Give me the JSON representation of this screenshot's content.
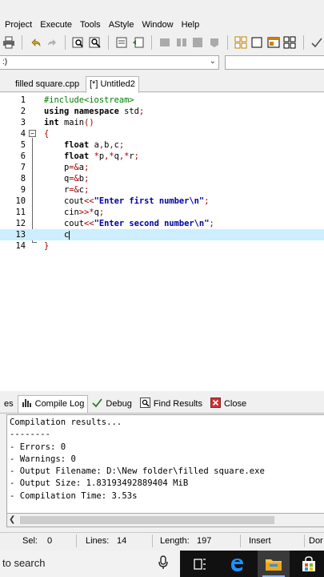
{
  "menu": [
    "Project",
    "Execute",
    "Tools",
    "AStyle",
    "Window",
    "Help"
  ],
  "toolbar": {
    "icons": [
      "print-icon",
      "undo-icon",
      "redo-icon",
      "find-icon",
      "replace-icon",
      "goto-icon",
      "bookmark-icon",
      "compile-icon",
      "run-icon",
      "rebuild-icon",
      "debug-icon",
      "grid-icon",
      "window-icon",
      "layout-icon",
      "tiles-icon",
      "check-icon"
    ]
  },
  "combo": {
    "value": ":)"
  },
  "editor_tabs": [
    "filled square.cpp",
    "[*] Untitled2"
  ],
  "code": {
    "lines": [
      {
        "num": "1",
        "parts": [
          {
            "c": "pp",
            "t": "#include<iostream>"
          }
        ]
      },
      {
        "num": "2",
        "parts": [
          {
            "c": "kw",
            "t": "using namespace"
          },
          {
            "c": "",
            "t": " std"
          },
          {
            "c": "sym",
            "t": ";"
          }
        ]
      },
      {
        "num": "3",
        "parts": [
          {
            "c": "kw",
            "t": "int"
          },
          {
            "c": "",
            "t": " main"
          },
          {
            "c": "sym",
            "t": "()"
          }
        ]
      },
      {
        "num": "4",
        "parts": [
          {
            "c": "sym",
            "t": "{"
          }
        ]
      },
      {
        "num": "5",
        "parts": [
          {
            "c": "",
            "t": "    "
          },
          {
            "c": "kw",
            "t": "float"
          },
          {
            "c": "",
            "t": " a"
          },
          {
            "c": "sym",
            "t": ","
          },
          {
            "c": "",
            "t": "b"
          },
          {
            "c": "sym",
            "t": ","
          },
          {
            "c": "",
            "t": "c"
          },
          {
            "c": "sym",
            "t": ";"
          }
        ]
      },
      {
        "num": "6",
        "parts": [
          {
            "c": "",
            "t": "    "
          },
          {
            "c": "kw",
            "t": "float"
          },
          {
            "c": "",
            "t": " "
          },
          {
            "c": "sym",
            "t": "*"
          },
          {
            "c": "",
            "t": "p"
          },
          {
            "c": "sym",
            "t": ",*"
          },
          {
            "c": "",
            "t": "q"
          },
          {
            "c": "sym",
            "t": ",*"
          },
          {
            "c": "",
            "t": "r"
          },
          {
            "c": "sym",
            "t": ";"
          }
        ]
      },
      {
        "num": "7",
        "parts": [
          {
            "c": "",
            "t": "    p"
          },
          {
            "c": "sym",
            "t": "=&"
          },
          {
            "c": "",
            "t": "a"
          },
          {
            "c": "sym",
            "t": ";"
          }
        ]
      },
      {
        "num": "8",
        "parts": [
          {
            "c": "",
            "t": "    q"
          },
          {
            "c": "sym",
            "t": "=&"
          },
          {
            "c": "",
            "t": "b"
          },
          {
            "c": "sym",
            "t": ";"
          }
        ]
      },
      {
        "num": "9",
        "parts": [
          {
            "c": "",
            "t": "    r"
          },
          {
            "c": "sym",
            "t": "=&"
          },
          {
            "c": "",
            "t": "c"
          },
          {
            "c": "sym",
            "t": ";"
          }
        ]
      },
      {
        "num": "10",
        "parts": [
          {
            "c": "",
            "t": "    cout"
          },
          {
            "c": "sym",
            "t": "<<"
          },
          {
            "c": "str",
            "t": "\"Enter first number\\n\""
          },
          {
            "c": "sym",
            "t": ";"
          }
        ]
      },
      {
        "num": "11",
        "parts": [
          {
            "c": "",
            "t": "    cin"
          },
          {
            "c": "sym",
            "t": ">>*"
          },
          {
            "c": "",
            "t": "q"
          },
          {
            "c": "sym",
            "t": ";"
          }
        ]
      },
      {
        "num": "12",
        "parts": [
          {
            "c": "",
            "t": "    cout"
          },
          {
            "c": "sym",
            "t": "<<"
          },
          {
            "c": "str",
            "t": "\"Enter second number\\n\""
          },
          {
            "c": "sym",
            "t": ";"
          }
        ]
      },
      {
        "num": "13",
        "parts": [
          {
            "c": "",
            "t": "    c"
          }
        ],
        "active": true
      },
      {
        "num": "14",
        "parts": [
          {
            "c": "sym",
            "t": "}"
          }
        ]
      }
    ]
  },
  "bottom_tabs": [
    {
      "label": "es",
      "icon": "",
      "name": "tab-resources"
    },
    {
      "label": "Compile Log",
      "icon": "chart-icon",
      "name": "tab-compile-log",
      "active": true
    },
    {
      "label": "Debug",
      "icon": "check-icon",
      "name": "tab-debug"
    },
    {
      "label": "Find Results",
      "icon": "find-icon",
      "name": "tab-find-results"
    },
    {
      "label": "Close",
      "icon": "close-icon",
      "name": "tab-close"
    }
  ],
  "compile_log": [
    "Compilation results...",
    "--------",
    "- Errors: 0",
    "- Warnings: 0",
    "- Output Filename: D:\\New folder\\filled square.exe",
    "- Output Size: 1.83193492889404 MiB",
    "- Compilation Time: 3.53s"
  ],
  "status": {
    "sel_label": "Sel:",
    "sel_value": "0",
    "lines_label": "Lines:",
    "lines_value": "14",
    "length_label": "Length:",
    "length_value": "197",
    "mode": "Insert",
    "extra": "Dor"
  },
  "taskbar": {
    "search_text": "to search",
    "icons": [
      "microphone-icon",
      "task-view-icon",
      "edge-icon",
      "file-explorer-icon",
      "store-icon"
    ]
  },
  "colors": {
    "active_line": "#cceeff",
    "keyword": "#000000",
    "preprocessor": "#008000",
    "string": "#0000a0",
    "symbol": "#a00000"
  }
}
